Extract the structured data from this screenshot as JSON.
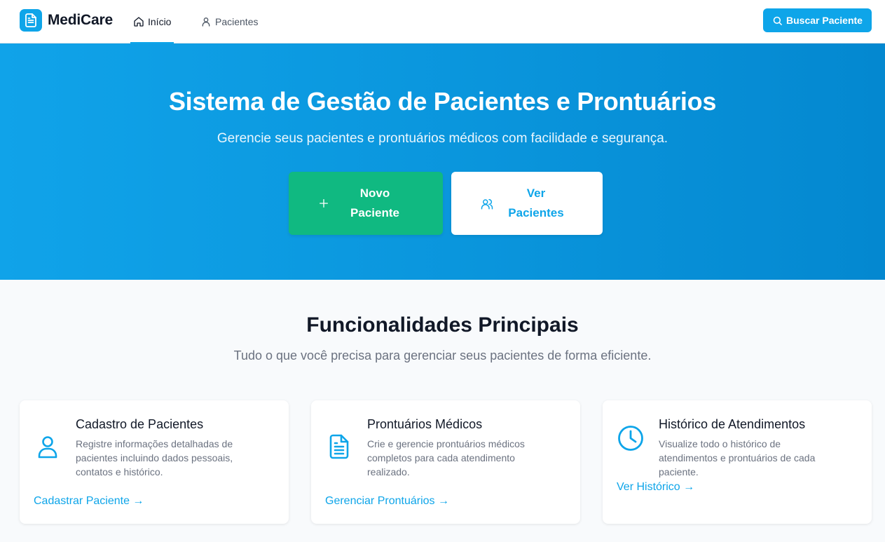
{
  "header": {
    "brand": "MediCare",
    "tabs": [
      {
        "label": "Início",
        "icon": "home-icon",
        "active": true
      },
      {
        "label": "Pacientes",
        "icon": "user-icon",
        "active": false
      }
    ],
    "search_button": "Buscar Paciente"
  },
  "hero": {
    "title": "Sistema de Gestão de Pacientes e Prontuários",
    "subtitle": "Gerencie seus pacientes e prontuários médicos com facilidade e segurança.",
    "primary_button": "Novo Paciente",
    "secondary_button": "Ver Pacientes"
  },
  "features": {
    "title": "Funcionalidades Principais",
    "subtitle": "Tudo o que você precisa para gerenciar seus pacientes de forma eficiente.",
    "cards": [
      {
        "icon": "user-icon",
        "title": "Cadastro de Pacientes",
        "description": "Registre informações detalhadas de pacientes incluindo dados pessoais, contatos e histórico.",
        "link": "Cadastrar Paciente →"
      },
      {
        "icon": "document-icon",
        "title": "Prontuários Médicos",
        "description": "Crie e gerencie prontuários médicos completos para cada atendimento realizado.",
        "link": "Gerenciar Prontuários →"
      },
      {
        "icon": "clock-icon",
        "title": "Histórico de Atendimentos",
        "description": "Visualize todo o histórico de atendimentos e prontuários de cada paciente.",
        "link": "Ver Histórico →"
      }
    ]
  },
  "colors": {
    "brand": "#0ea5e9",
    "success": "#10b981",
    "hero_start": "#10a3e9",
    "hero_end": "#0488d0"
  }
}
